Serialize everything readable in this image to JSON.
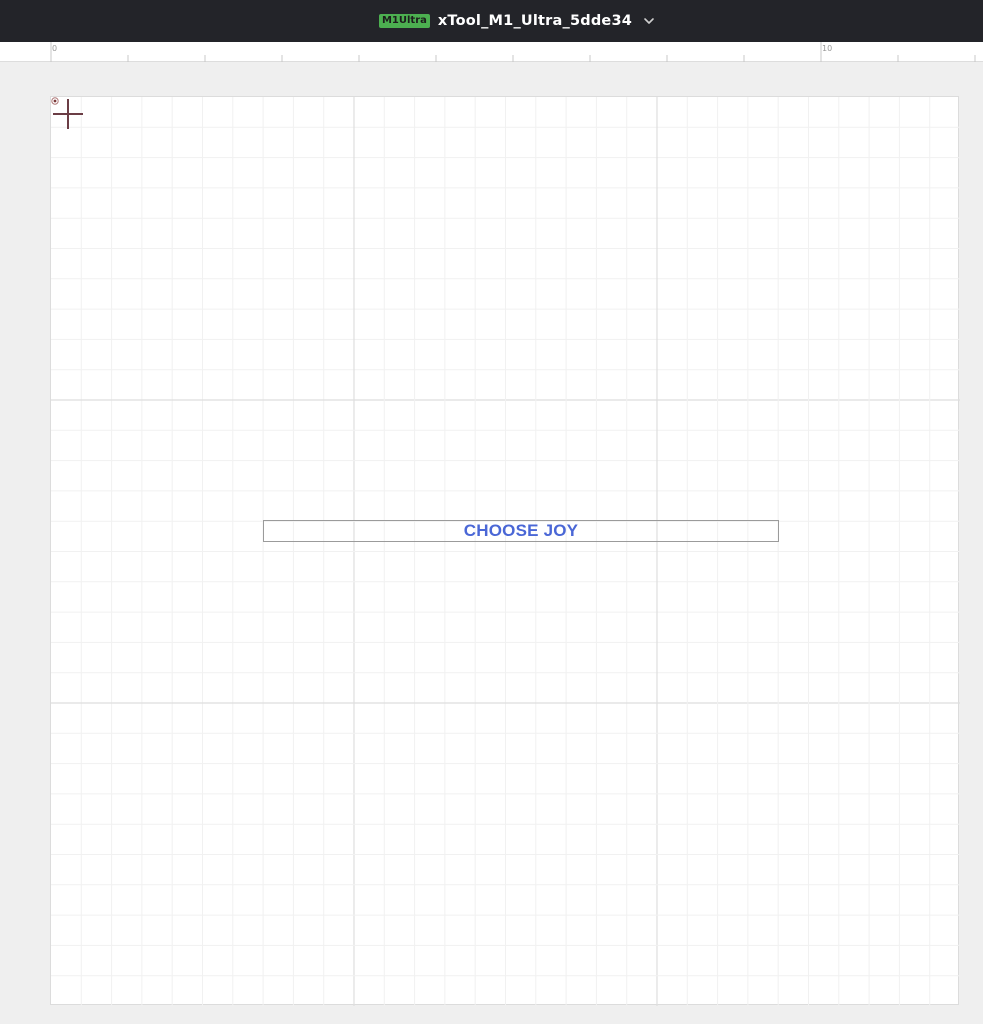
{
  "header": {
    "model_badge": "M1Ultra",
    "device_name": "xTool_M1_Ultra_5dde34",
    "dropdown_icon": "chevron-down-icon"
  },
  "ruler": {
    "labels": [
      "0",
      "10"
    ]
  },
  "canvas": {
    "text_object": "CHOOSE JOY",
    "text_color": "#4a67d6",
    "origin_marker_icon": "origin-dot-icon",
    "cursor_icon": "crosshair-icon"
  },
  "colors": {
    "topbar": "#232429",
    "badge": "#4caf50",
    "workspace": "#efefef"
  }
}
